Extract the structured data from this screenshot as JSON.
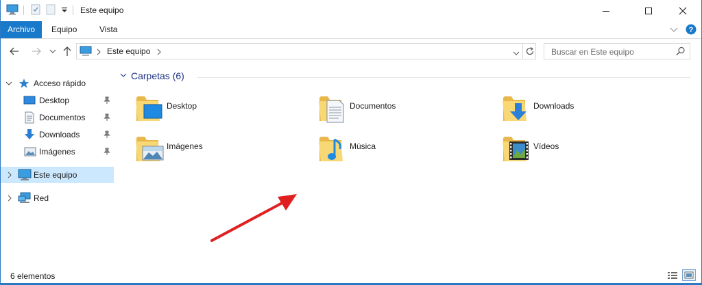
{
  "window": {
    "title": "Este equipo"
  },
  "ribbon": {
    "tabs": [
      {
        "label": "Archivo"
      },
      {
        "label": "Equipo"
      },
      {
        "label": "Vista"
      }
    ]
  },
  "address": {
    "path": "Este equipo",
    "search_placeholder": "Buscar en Este equipo"
  },
  "navpane": {
    "quick_access": "Acceso rápido",
    "quick_items": [
      {
        "label": "Desktop"
      },
      {
        "label": "Documentos"
      },
      {
        "label": "Downloads"
      },
      {
        "label": "Imágenes"
      }
    ],
    "this_pc": "Este equipo",
    "network": "Red"
  },
  "content": {
    "group_title": "Carpetas (6)",
    "folders": [
      {
        "label": "Desktop"
      },
      {
        "label": "Documentos"
      },
      {
        "label": "Downloads"
      },
      {
        "label": "Imágenes"
      },
      {
        "label": "Música"
      },
      {
        "label": "Vídeos"
      }
    ]
  },
  "status": {
    "count": "6 elementos"
  },
  "colors": {
    "accent": "#1979ca",
    "selection": "#cce8ff",
    "group_title": "#1e3287",
    "folder": "#f8d775",
    "annotation_arrow": "#e02020"
  }
}
